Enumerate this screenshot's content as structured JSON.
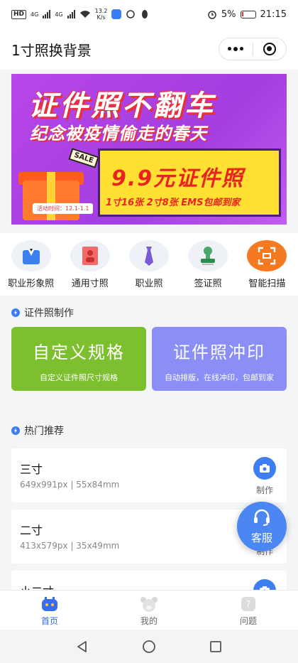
{
  "status_bar": {
    "network_badge": "HD",
    "signal_1": "4G",
    "signal_2": "4G",
    "speed_value": "13.2",
    "speed_unit": "K/s",
    "battery": "5%",
    "time": "21:15"
  },
  "header": {
    "title": "1寸照换背景"
  },
  "banner": {
    "headline": "证件照不翻车",
    "subline": "纪念被疫情偷走的春天",
    "sale_tag": "SALE",
    "activity_time": "活动时间：12.1-1.1",
    "price": "9.9元证件照",
    "price_detail": "1寸16张  2寸8张  EMS包邮到家"
  },
  "categories": [
    {
      "label": "职业形象照",
      "icon": "suit-icon"
    },
    {
      "label": "通用寸照",
      "icon": "id-photo-icon"
    },
    {
      "label": "职业照",
      "icon": "tie-icon"
    },
    {
      "label": "签证照",
      "icon": "stamp-icon"
    },
    {
      "label": "智能扫描",
      "icon": "scan-icon"
    }
  ],
  "section_make": {
    "title": "证件照制作"
  },
  "cards": [
    {
      "title": "自定义规格",
      "subtitle": "自定义证件照尺寸规格",
      "color": "#7cc02f"
    },
    {
      "title": "证件照冲印",
      "subtitle": "自动排版，在线冲印，包邮到家",
      "color": "#8a8ef5"
    }
  ],
  "section_hot": {
    "title": "热门推荐"
  },
  "hot_items": [
    {
      "title": "三寸",
      "spec": "649x991px | 55x84mm",
      "action": "制作"
    },
    {
      "title": "二寸",
      "spec": "413x579px | 35x49mm",
      "action": "制作"
    },
    {
      "title": "小二寸",
      "spec": "",
      "action": "制作"
    }
  ],
  "fab": {
    "label": "客服"
  },
  "tabs": [
    {
      "label": "首页",
      "active": true
    },
    {
      "label": "我的",
      "active": false
    },
    {
      "label": "问题",
      "active": false
    }
  ],
  "colors": {
    "accent": "#3d7ff0",
    "banner_bg": "#b846e8",
    "price_panel": "#ffe033",
    "price_text": "#e82420"
  }
}
